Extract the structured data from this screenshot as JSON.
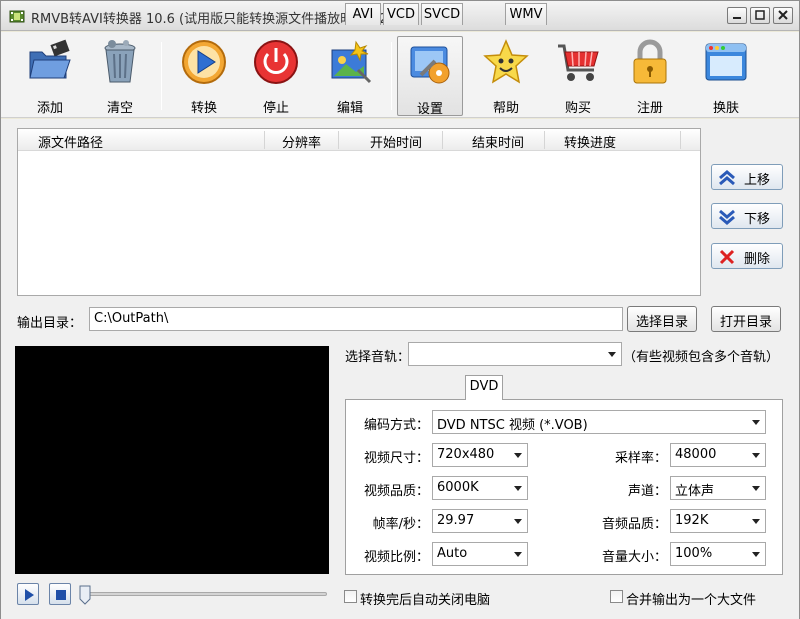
{
  "window": {
    "title": "RMVB转AVI转换器 10.6 (试用版只能转换源文件播放时间的20%)"
  },
  "toolbar": {
    "add": "添加",
    "clear": "清空",
    "convert": "转换",
    "stop": "停止",
    "edit": "编辑",
    "settings": "设置",
    "help": "帮助",
    "buy": "购买",
    "register": "注册",
    "skin": "换肤"
  },
  "filelist": {
    "columns": [
      "源文件路径",
      "分辨率",
      "开始时间",
      "结束时间",
      "转换进度"
    ]
  },
  "side": {
    "up": "上移",
    "down": "下移",
    "delete": "删除"
  },
  "output": {
    "label": "输出目录：",
    "path": "C:\\OutPath\\",
    "choose": "选择目录",
    "open": "打开目录"
  },
  "audio_track": {
    "label": "选择音轨：",
    "value": "",
    "hint": "（有些视频包含多个音轨）"
  },
  "tabs": [
    "AVI",
    "VCD",
    "SVCD",
    "DVD",
    "WMV"
  ],
  "active_tab": "DVD",
  "settings": {
    "encode": {
      "label": "编码方式：",
      "value": "DVD NTSC 视频 (*.VOB)"
    },
    "size": {
      "label": "视频尺寸：",
      "value": "720x480"
    },
    "quality": {
      "label": "视频品质：",
      "value": "6000K"
    },
    "fps": {
      "label": "帧率/秒：",
      "value": "29.97"
    },
    "aspect": {
      "label": "视频比例：",
      "value": "Auto"
    },
    "samplerate": {
      "label": "采样率：",
      "value": "48000"
    },
    "channels": {
      "label": "声道：",
      "value": "立体声"
    },
    "audioquality": {
      "label": "音频品质：",
      "value": "192K"
    },
    "volume": {
      "label": "音量大小：",
      "value": "100%"
    }
  },
  "options": {
    "shutdown": "转换完后自动关闭电脑",
    "merge": "合并输出为一个大文件"
  },
  "player": {
    "progress": 0
  }
}
